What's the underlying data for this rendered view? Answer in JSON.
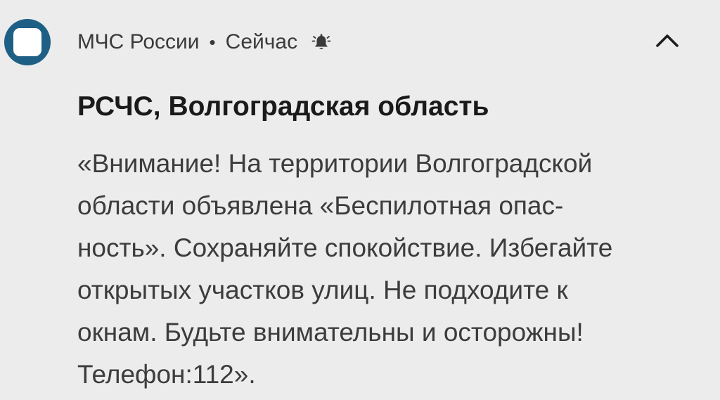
{
  "notification": {
    "app_name": "МЧС России",
    "separator": "•",
    "time": "Сейчас",
    "title": "РСЧС, Волгоградская область",
    "body_lines": [
      "«Внимание! На территории Волгоградской",
      "области объявлена «Беспилотная опас-",
      "ность». Сохраняйте спокойствие. Избегайте",
      "открытых участков улиц. Не подходите к",
      "окнам. Будьте внимательны и осторожны!",
      "Телефон:112»."
    ],
    "icons": {
      "app": "app-icon",
      "alert": "bell-alert-icon",
      "collapse": "chevron-up-icon"
    },
    "colors": {
      "background": "#ececec",
      "app_icon": "#1e5f86",
      "title": "#1a1a1a",
      "body": "#3c3c3c"
    }
  }
}
